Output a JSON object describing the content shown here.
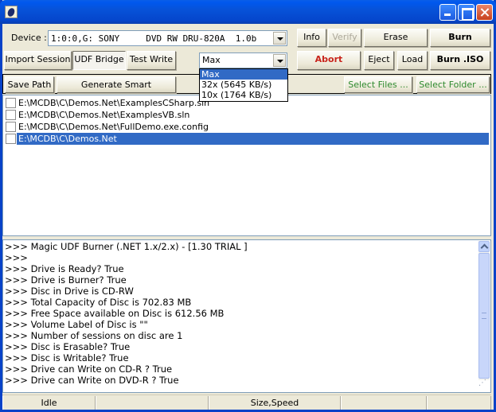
{
  "window": {
    "title": "",
    "icon": "magic-udf-app-icon",
    "controls": [
      "minimize",
      "maximize",
      "close"
    ]
  },
  "device": {
    "label": "Device :",
    "selected": "1:0:0,G: SONY     DVD RW DRU-820A  1.0b"
  },
  "toolbar_row1": {
    "info": "Info",
    "verify": "Verify",
    "erase": "Erase",
    "burn": "Burn"
  },
  "toolbar_row2": {
    "import_session": "Import Session",
    "udf_bridge": "UDF Bridge",
    "test_write": "Test Write",
    "abort": "Abort",
    "eject": "Eject",
    "load": "Load",
    "burn_iso": "Burn .ISO"
  },
  "speed": {
    "selected": "Max",
    "options": [
      "Max",
      "32x (5645 KB/s)",
      "10x (1764 KB/s)"
    ],
    "highlighted_index": 0
  },
  "file_bar": {
    "save_path": "Save Path",
    "generate_refs": "Generate Smart References",
    "select_files": "Select Files ...",
    "select_folder": "Select Folder ..."
  },
  "files": [
    {
      "path": "E:\\MCDB\\C\\Demos.Net\\ExamplesCSharp.sln",
      "checked": false,
      "selected": false
    },
    {
      "path": "E:\\MCDB\\C\\Demos.Net\\ExamplesVB.sln",
      "checked": false,
      "selected": false
    },
    {
      "path": "E:\\MCDB\\C\\Demos.Net\\FullDemo.exe.config",
      "checked": false,
      "selected": false
    },
    {
      "path": "E:\\MCDB\\C\\Demos.Net",
      "checked": false,
      "selected": true
    }
  ],
  "log": [
    ">>> Magic UDF Burner (.NET 1.x/2.x) - [1.30 TRIAL ]",
    ">>>",
    ">>> Drive is Ready? True",
    ">>> Drive is Burner? True",
    ">>> Disc in Drive is CD-RW",
    ">>> Total Capacity of Disc is 702.83 MB",
    ">>> Free Space available on Disc is 612.56 MB",
    ">>> Volume Label of Disc is \"\"",
    ">>> Number of sessions on disc are 1",
    ">>> Disc is Erasable? True",
    ">>> Disc is Writable? True",
    ">>> Drive can Write on CD-R ? True",
    ">>> Drive can Write on DVD-R ? True"
  ],
  "status": {
    "state": "Idle",
    "cell2": "",
    "size_speed": "Size,Speed",
    "cell4": "",
    "cell5": ""
  },
  "colors": {
    "titlebar": "#0752d8",
    "selection": "#316ac5",
    "abort_text": "#c8241c",
    "select_text": "#2e8a2e",
    "face": "#ece9d8"
  }
}
